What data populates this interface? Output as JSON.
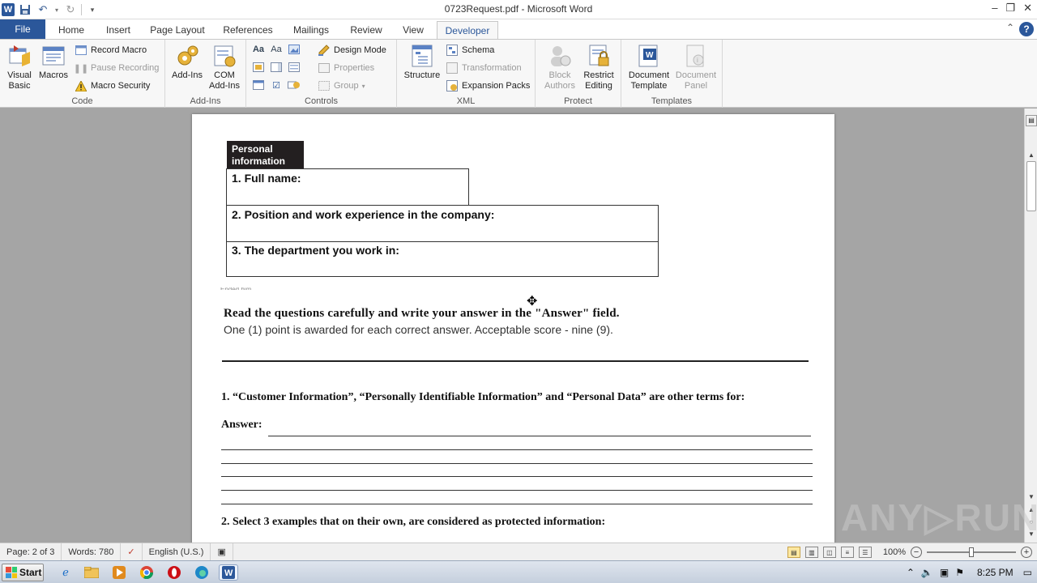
{
  "window": {
    "title": "0723Request.pdf  -  Microsoft Word",
    "app_icon_letter": "W",
    "controls": [
      "–",
      "❐",
      "✕"
    ]
  },
  "quick_access": {
    "save": "💾",
    "undo": "↶",
    "redo": "↻",
    "customize": "▾"
  },
  "tabs": [
    {
      "label": "File"
    },
    {
      "label": "Home"
    },
    {
      "label": "Insert"
    },
    {
      "label": "Page Layout"
    },
    {
      "label": "References"
    },
    {
      "label": "Mailings"
    },
    {
      "label": "Review"
    },
    {
      "label": "View"
    },
    {
      "label": "Developer"
    }
  ],
  "ribbon": {
    "code": {
      "label": "Code",
      "visual_basic": [
        "Visual",
        "Basic"
      ],
      "macros": "Macros",
      "record_macro": "Record Macro",
      "pause_recording": "Pause Recording",
      "macro_security": "Macro Security"
    },
    "addins": {
      "label": "Add-Ins",
      "addins_button": "Add-Ins",
      "com_addins": [
        "COM",
        "Add-Ins"
      ]
    },
    "controls": {
      "label": "Controls",
      "design_mode": "Design Mode",
      "properties": "Properties",
      "group": "Group"
    },
    "xml": {
      "label": "XML",
      "structure": "Structure",
      "schema": "Schema",
      "transformation": "Transformation",
      "expansion_packs": "Expansion Packs"
    },
    "protect": {
      "label": "Protect",
      "block_authors": [
        "Block",
        "Authors"
      ],
      "restrict_editing": [
        "Restrict",
        "Editing"
      ]
    },
    "templates": {
      "label": "Templates",
      "document_template": [
        "Document",
        "Template"
      ],
      "document_panel": [
        "Document",
        "Panel"
      ]
    }
  },
  "document": {
    "personal_header": [
      "Personal",
      "information"
    ],
    "fields": [
      "1. Full name:",
      "2. Position and work experience in the company:",
      "3. The department you work in:"
    ],
    "faint_text": "Ended him",
    "instruction_bold": "Read the questions carefully and write your answer in the \"Answer\" field.",
    "instruction_plain": "One (1) point is awarded for each correct answer. Acceptable score - nine (9).",
    "question1": "1. “Customer Information”, “Personally Identifiable Information” and “Personal Data” are other terms for:",
    "answer_label": "Answer:",
    "question2": "2. Select 3 examples that on their own, are considered as protected information:"
  },
  "status": {
    "page": "Page: 2 of 3",
    "words": "Words: 780",
    "language": "English (U.S.)",
    "zoom": "100%",
    "zoom_level_percent": 100
  },
  "taskbar": {
    "start": "Start",
    "time": "8:25 PM"
  },
  "watermark": "ANY▷RUN"
}
